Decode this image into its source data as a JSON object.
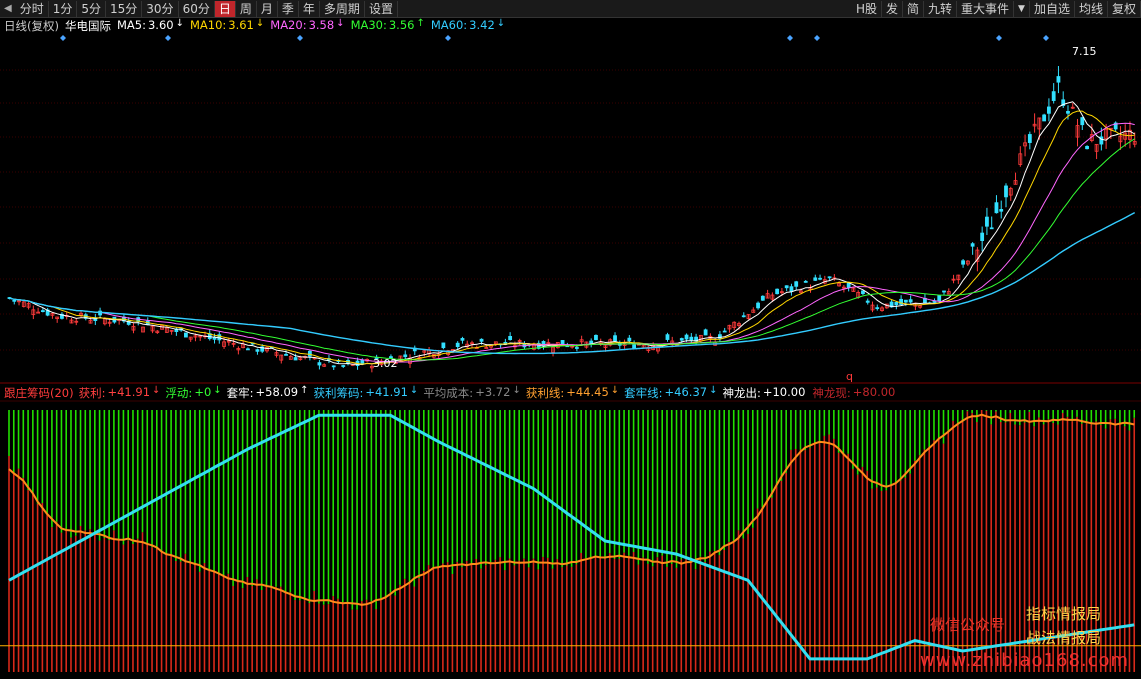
{
  "toolbar": {
    "left_tabs": [
      "分时",
      "1分",
      "5分",
      "15分",
      "30分",
      "60分",
      "日",
      "周",
      "月",
      "季",
      "年",
      "多周期",
      "设置"
    ],
    "active_tab": "日",
    "right_tabs": [
      "H股",
      "发",
      "简",
      "九转",
      "重大事件",
      "加自选",
      "均线",
      "复权"
    ],
    "dropdown_glyph": "▼",
    "back_glyph": "◀"
  },
  "price_header": {
    "period_label": "日线(复权)",
    "stock_name": "华电国际",
    "ma": [
      {
        "label": "MA5:",
        "value": "3.60",
        "arrow": "↓",
        "color": "#ffffff"
      },
      {
        "label": "MA10:",
        "value": "3.61",
        "arrow": "↓",
        "color": "#ffd700"
      },
      {
        "label": "MA20:",
        "value": "3.58",
        "arrow": "↓",
        "color": "#ff66ff"
      },
      {
        "label": "MA30:",
        "value": "3.56",
        "arrow": "↑",
        "color": "#33ff33"
      },
      {
        "label": "MA60:",
        "value": "3.42",
        "arrow": "↓",
        "color": "#33ccff"
      }
    ]
  },
  "annotations": {
    "high_label": "7.15",
    "low_label": "3.02",
    "marker_q": "q"
  },
  "indicator_header": {
    "name": "跟庄筹码(20)",
    "items": [
      {
        "label": "获利:",
        "value": "+41.91",
        "arrow": "↓",
        "color": "#ff4040"
      },
      {
        "label": "浮动:",
        "value": "+0",
        "arrow": "↓",
        "color": "#33ff33"
      },
      {
        "label": "套牢:",
        "value": "+58.09",
        "arrow": "↑",
        "color": "#ffffff"
      },
      {
        "label": "获利筹码:",
        "value": "+41.91",
        "arrow": "↓",
        "color": "#33ccff"
      },
      {
        "label": "平均成本:",
        "value": "+3.72",
        "arrow": "↓",
        "color": "#888888"
      },
      {
        "label": "获利线:",
        "value": "+44.45",
        "arrow": "↓",
        "color": "#ffa030"
      },
      {
        "label": "套牢线:",
        "value": "+46.37",
        "arrow": "↓",
        "color": "#33ccff"
      },
      {
        "label": "神龙出:",
        "value": "+10.00",
        "arrow": "",
        "color": "#ffffff"
      },
      {
        "label": "神龙现:",
        "value": "+80.00",
        "arrow": "",
        "color": "#c0262b"
      }
    ]
  },
  "watermark": {
    "wechat": "微信公众号",
    "line1": "指标情报局",
    "line2": "战法情报局",
    "site": "www.zhibiao168.com"
  },
  "colors": {
    "up": "#ff3b3b",
    "down": "#33e0ff",
    "ma5": "#ffffff",
    "ma10": "#ffd700",
    "ma20": "#ff66ff",
    "ma30": "#33ff33",
    "ma60": "#33ccff",
    "profit_bar": "#d8291a",
    "trap_bar": "#22e000",
    "profit_line": "#ff8c1a",
    "trap_line": "#33e0f0",
    "ref_line": "#ffb000",
    "marker": "#4aa3ff"
  },
  "chart_data": [
    {
      "type": "candlestick",
      "title": "",
      "price_range": [
        2.85,
        7.4
      ],
      "key_points": [
        {
          "x": 0,
          "y": 3.95
        },
        {
          "x": 10,
          "y": 3.72
        },
        {
          "x": 25,
          "y": 3.65
        },
        {
          "x": 40,
          "y": 3.45
        },
        {
          "x": 55,
          "y": 3.25
        },
        {
          "x": 70,
          "y": 3.05
        },
        {
          "x": 80,
          "y": 3.15
        },
        {
          "x": 95,
          "y": 3.35
        },
        {
          "x": 115,
          "y": 3.35
        },
        {
          "x": 135,
          "y": 3.35
        },
        {
          "x": 148,
          "y": 3.42
        },
        {
          "x": 160,
          "y": 4.0
        },
        {
          "x": 172,
          "y": 4.2
        },
        {
          "x": 182,
          "y": 3.85
        },
        {
          "x": 195,
          "y": 3.9
        },
        {
          "x": 205,
          "y": 4.8
        },
        {
          "x": 210,
          "y": 5.5
        },
        {
          "x": 220,
          "y": 6.7
        },
        {
          "x": 226,
          "y": 6.0
        },
        {
          "x": 236,
          "y": 6.1
        }
      ],
      "annotations": [
        "7.15",
        "3.02"
      ]
    },
    {
      "type": "bar",
      "title": "",
      "y_range": [
        0,
        100
      ],
      "profit_key_points": [
        {
          "x": 0,
          "y": 80
        },
        {
          "x": 10,
          "y": 55
        },
        {
          "x": 30,
          "y": 50
        },
        {
          "x": 45,
          "y": 35
        },
        {
          "x": 60,
          "y": 30
        },
        {
          "x": 75,
          "y": 25
        },
        {
          "x": 90,
          "y": 40
        },
        {
          "x": 110,
          "y": 42
        },
        {
          "x": 130,
          "y": 43
        },
        {
          "x": 145,
          "y": 42
        },
        {
          "x": 155,
          "y": 54
        },
        {
          "x": 165,
          "y": 85
        },
        {
          "x": 172,
          "y": 90
        },
        {
          "x": 182,
          "y": 70
        },
        {
          "x": 190,
          "y": 78
        },
        {
          "x": 200,
          "y": 98
        },
        {
          "x": 236,
          "y": 95
        }
      ],
      "trap_key_points": [
        {
          "x": 0,
          "y": 35
        },
        {
          "x": 15,
          "y": 50
        },
        {
          "x": 30,
          "y": 65
        },
        {
          "x": 50,
          "y": 85
        },
        {
          "x": 65,
          "y": 98
        },
        {
          "x": 80,
          "y": 98
        },
        {
          "x": 90,
          "y": 88
        },
        {
          "x": 110,
          "y": 70
        },
        {
          "x": 125,
          "y": 50
        },
        {
          "x": 140,
          "y": 45
        },
        {
          "x": 155,
          "y": 35
        },
        {
          "x": 168,
          "y": 5
        },
        {
          "x": 180,
          "y": 5
        },
        {
          "x": 190,
          "y": 12
        },
        {
          "x": 200,
          "y": 8
        },
        {
          "x": 236,
          "y": 18
        }
      ],
      "ref_level": 10
    }
  ]
}
